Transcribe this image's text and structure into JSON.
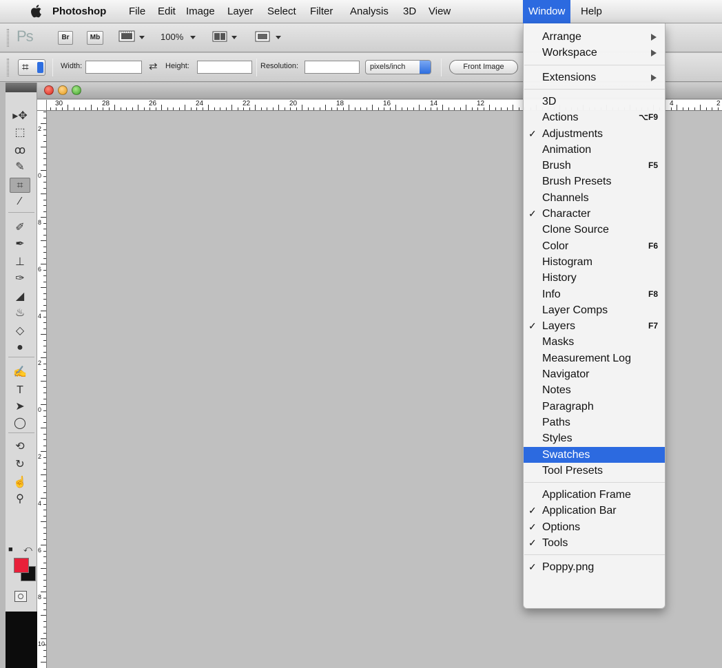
{
  "menubar": {
    "app": "Photoshop",
    "items": [
      "File",
      "Edit",
      "Image",
      "Layer",
      "Select",
      "Filter",
      "Analysis",
      "3D",
      "View",
      "Window",
      "Help"
    ],
    "active": "Window"
  },
  "appbar": {
    "logo": "Ps",
    "bridge_label": "Br",
    "minibridge_label": "Mb",
    "zoom_label": "100%"
  },
  "options": {
    "width_label": "Width:",
    "width_value": "",
    "height_label": "Height:",
    "height_value": "",
    "resolution_label": "Resolution:",
    "resolution_value": "",
    "resolution_unit": "pixels/inch",
    "front_image_label": "Front Image"
  },
  "ruler": {
    "h_labels": [
      "30",
      "28",
      "26",
      "24",
      "22",
      "20",
      "18",
      "16",
      "14",
      "12",
      "4",
      "2"
    ],
    "v_labels": [
      "2",
      "0",
      "8",
      "6",
      "4",
      "2",
      "0",
      "2",
      "4",
      "6",
      "8",
      "10"
    ]
  },
  "colors": {
    "foreground": "#e8203a",
    "background": "#111111",
    "menu_highlight": "#2c6ae0"
  },
  "window_menu": {
    "items": [
      {
        "label": "Arrange",
        "submenu": true
      },
      {
        "label": "Workspace",
        "submenu": true
      },
      {
        "separator": true
      },
      {
        "label": "Extensions",
        "submenu": true
      },
      {
        "separator": true
      },
      {
        "label": "3D"
      },
      {
        "label": "Actions",
        "shortcut": "⌥F9"
      },
      {
        "label": "Adjustments",
        "checked": true
      },
      {
        "label": "Animation"
      },
      {
        "label": "Brush",
        "shortcut": "F5"
      },
      {
        "label": "Brush Presets"
      },
      {
        "label": "Channels"
      },
      {
        "label": "Character",
        "checked": true
      },
      {
        "label": "Clone Source"
      },
      {
        "label": "Color",
        "shortcut": "F6"
      },
      {
        "label": "Histogram"
      },
      {
        "label": "History"
      },
      {
        "label": "Info",
        "shortcut": "F8"
      },
      {
        "label": "Layer Comps"
      },
      {
        "label": "Layers",
        "checked": true,
        "shortcut": "F7"
      },
      {
        "label": "Masks"
      },
      {
        "label": "Measurement Log"
      },
      {
        "label": "Navigator"
      },
      {
        "label": "Notes"
      },
      {
        "label": "Paragraph"
      },
      {
        "label": "Paths"
      },
      {
        "label": "Styles"
      },
      {
        "label": "Swatches",
        "highlighted": true
      },
      {
        "label": "Tool Presets"
      },
      {
        "separator": true
      },
      {
        "label": "Application Frame"
      },
      {
        "label": "Application Bar",
        "checked": true
      },
      {
        "label": "Options",
        "checked": true
      },
      {
        "label": "Tools",
        "checked": true
      },
      {
        "separator": true
      },
      {
        "label": "Poppy.png",
        "checked": true
      }
    ]
  },
  "tools": [
    {
      "icon": "move-icon",
      "glyph": "▸✥"
    },
    {
      "icon": "marquee-icon",
      "glyph": "⬚"
    },
    {
      "icon": "lasso-icon",
      "glyph": "ꝏ"
    },
    {
      "icon": "quick-selection-icon",
      "glyph": "✎"
    },
    {
      "icon": "crop-icon",
      "glyph": "⌗",
      "selected": true
    },
    {
      "icon": "eyedropper-icon",
      "glyph": "⁄"
    },
    {
      "icon": "healing-brush-icon",
      "glyph": "✐"
    },
    {
      "icon": "brush-icon",
      "glyph": "✒"
    },
    {
      "icon": "clone-stamp-icon",
      "glyph": "⊥"
    },
    {
      "icon": "history-brush-icon",
      "glyph": "✑"
    },
    {
      "icon": "eraser-icon",
      "glyph": "◢"
    },
    {
      "icon": "paint-bucket-icon",
      "glyph": "♨"
    },
    {
      "icon": "blur-icon",
      "glyph": "◇"
    },
    {
      "icon": "dodge-icon",
      "glyph": "●"
    },
    {
      "icon": "pen-icon",
      "glyph": "✍"
    },
    {
      "icon": "type-icon",
      "glyph": "T"
    },
    {
      "icon": "path-selection-icon",
      "glyph": "➤"
    },
    {
      "icon": "ellipse-icon",
      "glyph": "◯"
    },
    {
      "icon": "3d-rotate-icon",
      "glyph": "⟲"
    },
    {
      "icon": "3d-orbit-icon",
      "glyph": "↻"
    },
    {
      "icon": "hand-icon",
      "glyph": "☝"
    },
    {
      "icon": "zoom-icon",
      "glyph": "⚲"
    }
  ]
}
